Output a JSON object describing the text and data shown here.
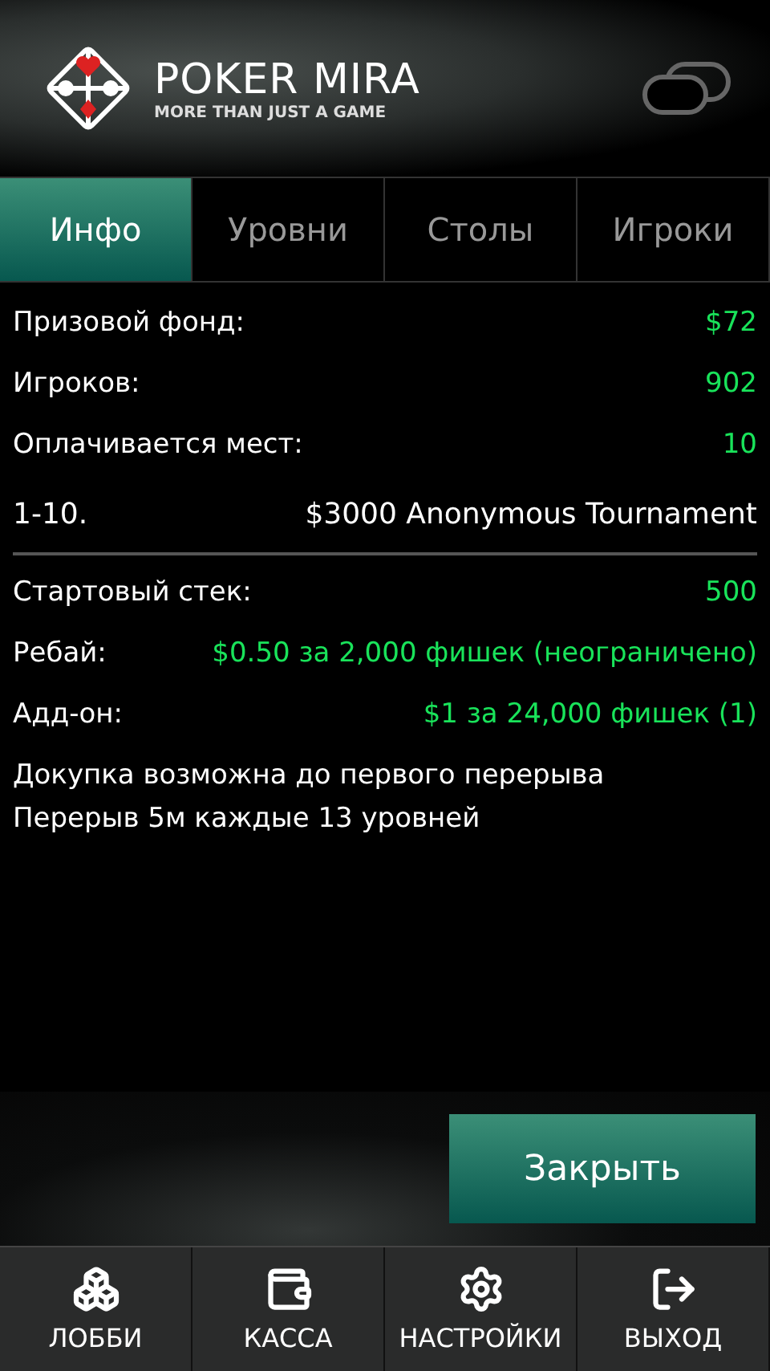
{
  "header": {
    "brand": "POKER MIRA",
    "tagline": "MORE THAN JUST A GAME"
  },
  "tabs": [
    {
      "label": "Инфо",
      "selected": true
    },
    {
      "label": "Уровни",
      "selected": false
    },
    {
      "label": "Столы",
      "selected": false
    },
    {
      "label": "Игроки",
      "selected": false
    }
  ],
  "stats": [
    {
      "label": "Призовой фонд:",
      "value": "$72"
    },
    {
      "label": "Игроков:",
      "value": "902"
    },
    {
      "label": "Оплачивается мест:",
      "value": "10"
    }
  ],
  "payouts": [
    {
      "places": "1-10.",
      "prize": "$3000 Anonymous Tournament"
    }
  ],
  "details": [
    {
      "label": "Стартовый стек:",
      "value": "500"
    },
    {
      "label": "Ребай:",
      "value": "$0.50 за 2,000 фишек (неограничено)"
    },
    {
      "label": "Адд-он:",
      "value": "$1 за 24,000 фишек (1)"
    }
  ],
  "notes": [
    "Докупка возможна до первого перерыва",
    "Перерыв 5м каждые 13 уровней"
  ],
  "close_button": "Закрыть",
  "nav": [
    {
      "kind": "lobby",
      "label": "ЛОББИ"
    },
    {
      "kind": "cashier",
      "label": "КАССА"
    },
    {
      "kind": "settings",
      "label": "НАСТРОЙКИ"
    },
    {
      "kind": "exit",
      "label": "ВЫХОД"
    }
  ]
}
